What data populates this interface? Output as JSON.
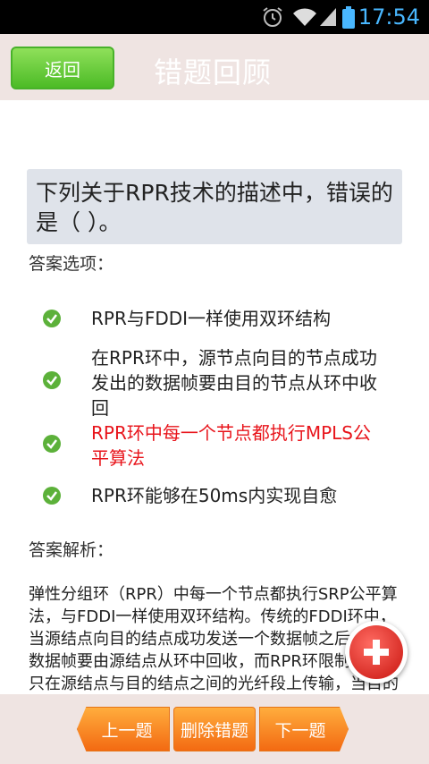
{
  "status_bar": {
    "time": "17:54"
  },
  "header": {
    "back_label": "返回",
    "title": "错题回顾"
  },
  "question": {
    "text": "下列关于RPR技术的描述中，错误的是（ ）。"
  },
  "options_label": "答案选项：",
  "options": [
    {
      "text": "RPR与FDDI一样使用双环结构",
      "state": "normal"
    },
    {
      "text": "在RPR环中，源节点向目的节点成功发出的数据帧要由目的节点从环中收回",
      "state": "normal"
    },
    {
      "text": "RPR环中每一个节点都执行MPLS公平算法",
      "state": "wrong"
    },
    {
      "text": "RPR环能够在50ms内实现自愈",
      "state": "normal"
    }
  ],
  "analysis_label": "答案解析：",
  "analysis": {
    "text": "弹性分组环（RPR）中每一个节点都执行SRP公平算法，与FDDI一样使用双环结构。传统的FDDI环中，当源结点向目的结点成功发送一个数据帧之后，这个数据帧要由源结点从环中回收，而RPR环限制数据帧只在源结点与目的结点之间的光纤段上传输，当目的结"
  },
  "bottom_bar": {
    "prev_label": "上一题",
    "delete_label": "删除错题",
    "next_label": "下一题"
  },
  "colors": {
    "accent_green": "#4cbb26",
    "wrong_red": "#e8141b",
    "nav_orange": "#f36a12",
    "fab_red": "#c8140e",
    "header_bg": "#efe4e2"
  },
  "icons": {
    "alarm": "alarm-icon",
    "wifi": "wifi-icon",
    "signal": "signal-icon",
    "battery": "battery-icon",
    "check": "check-circle-icon",
    "add": "plus-icon"
  }
}
